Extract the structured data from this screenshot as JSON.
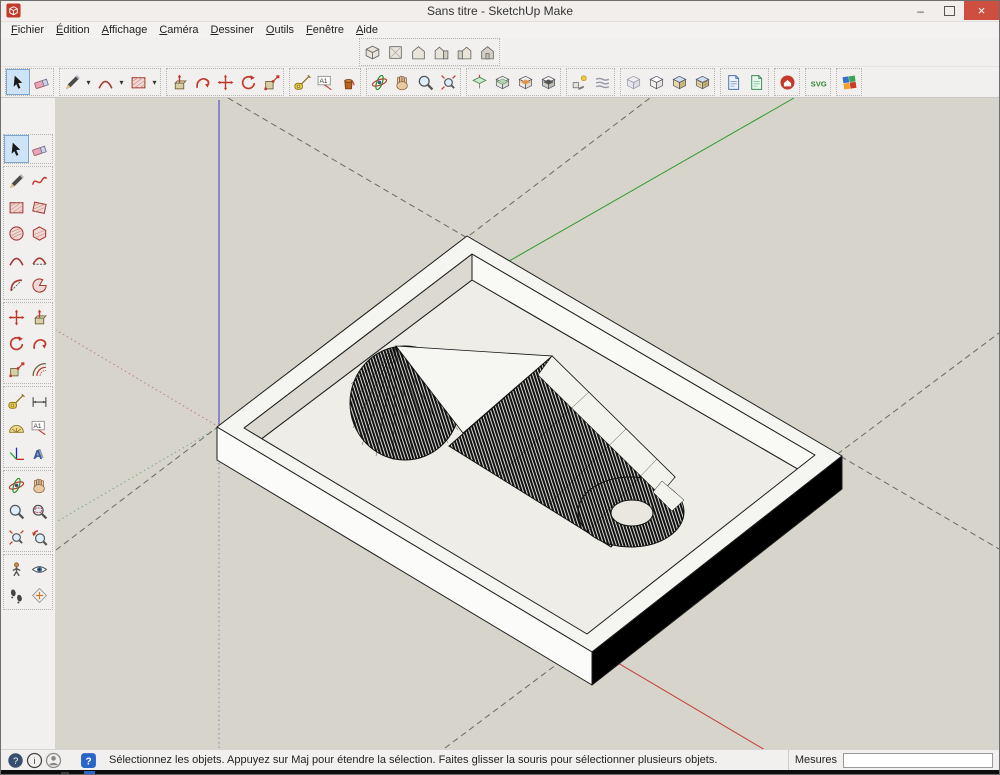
{
  "window": {
    "title": "Sans titre - SketchUp Make",
    "minimize_glyph": "–",
    "close_glyph": "×"
  },
  "menu_bar": {
    "items": [
      "Fichier",
      "Édition",
      "Affichage",
      "Caméra",
      "Dessiner",
      "Outils",
      "Fenêtre",
      "Aide"
    ]
  },
  "toolbars": {
    "caret_glyph": "▾",
    "text_tool_glyph": "A1",
    "svg_button_label": "SVG"
  },
  "status_bar": {
    "message": "Sélectionnez les objets. Appuyez sur Maj pour étendre la sélection. Faites glisser la souris pour sélectionner plusieurs objets.",
    "help_glyph": "?",
    "info_glyph": "i",
    "measures_label": "Mesures",
    "measures_value": ""
  },
  "colors": {
    "viewport_bg": "#d7d4cb",
    "axis_red": "#c43a2e",
    "axis_green": "#2f9a2f",
    "axis_blue": "#3d3dc4",
    "close_button": "#ce4f3f",
    "selection_highlight": "#cfe3f6"
  },
  "icon_names": {
    "select": "arrow-cursor",
    "eraser": "pink-eraser",
    "pencil": "line-pencil",
    "freehand": "red-squiggle",
    "rect": "hatched-rectangle",
    "rotrect": "rotated-rectangle",
    "circle": "hatched-circle",
    "polygon": "hatched-hexagon",
    "arc1": "arc-curve",
    "arc2": "two-point-arc",
    "arc3": "three-point-arc",
    "pie": "pie-wedge",
    "move": "red-cross-arrows",
    "pushpull": "box-up-arrow",
    "rotate": "circular-arrow",
    "followme": "spiral-arrow",
    "scale": "scale-handles",
    "offset": "concentric-arcs",
    "tape": "tape-measure",
    "dimension": "dimension-arrows",
    "protractor": "yellow-protractor",
    "texttool": "text-label",
    "axes": "rgb-axes",
    "text3d": "extruded-letter",
    "orbit": "orbit-ellipses",
    "pan": "hand",
    "zoom": "magnifier",
    "zoomwin": "magnifier-window",
    "zoomext": "magnifier-arrows",
    "previous": "magnifier-undo",
    "poscam": "figure",
    "lookaround": "eye",
    "walk": "footprints",
    "sectionplane": "section-diamond",
    "paint": "paint-bucket",
    "viewiso": "iso-cube",
    "viewtop": "plan-square",
    "viewfront": "house-front",
    "viewright": "house-right",
    "viewleft": "house-left",
    "viewback": "house-back",
    "secplane": "section-plane",
    "secdisplay": "section-display",
    "seccut": "section-cut",
    "secfill": "section-fill",
    "shadows": "sun-shadow",
    "fog": "fog-waves",
    "stylexray": "xray-cube",
    "stylehidden": "hidden-line-cube",
    "styleshaded": "shaded-cube",
    "styletextured": "textured-cube",
    "extdoc1": "blue-document",
    "extdoc2": "green-document",
    "warehouse": "red-warehouse-circle",
    "svgexp": "svg-text",
    "colorgrid": "color-grid",
    "helpc": "help-circle",
    "infoc": "info-circle",
    "userc": "user-circle",
    "bluehelp": "blue-help-square"
  }
}
